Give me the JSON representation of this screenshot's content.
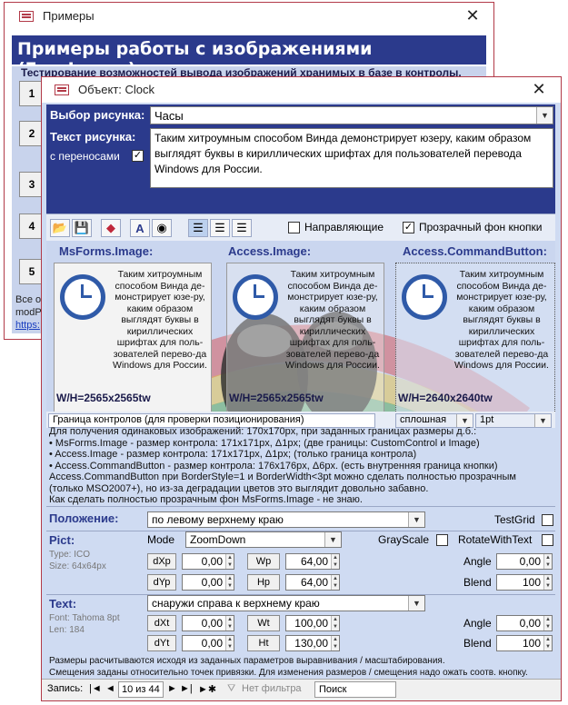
{
  "back_window": {
    "title": "Примеры",
    "close": "✕",
    "header": "Примеры работы с изображениями (FreeImage)",
    "subheader": "Тестирование возможностей вывода изображений хранимых в базе в контролы.",
    "buttons": [
      "1",
      "2",
      "3",
      "4",
      "5"
    ],
    "footer_line1": "Все ос",
    "footer_line2": "modPic",
    "footer_link": "https:"
  },
  "front_window": {
    "title": "Объект: Clock",
    "close": "✕",
    "select_label": "Выбор рисунка:",
    "select_value": "Часы",
    "text_label": "Текст рисунка:",
    "wrap_label": "с переносами",
    "wrap_checked": "✓",
    "text_value": "Таким хитроумным способом Винда демонстрирует юзеру, каким образом выглядят буквы в кириллических шрифтах для пользователей перевода Windows для России.",
    "toolbar": {
      "guides_label": "Направляющие",
      "transparent_label": "Прозрачный фон кнопки",
      "transparent_checked": "✓",
      "icons": [
        "open-icon",
        "save-icon",
        "eraser-icon",
        "font-icon",
        "color-icon",
        "align-left-icon",
        "align-center-icon",
        "align-right-icon"
      ]
    },
    "panes": [
      {
        "title": "MsForms.Image:",
        "text": "Таким хитроумным способом Винда де-монстрирует юзе-ру, каким образом выглядят буквы в кириллических шрифтах для поль-зователей перево-да Windows для России.",
        "wh": "W/H=2565x2565tw"
      },
      {
        "title": "Access.Image:",
        "text": "Таким хитроумным способом Винда де-монстрирует юзе-ру, каким образом выглядят буквы в кириллических шрифтах для поль-зователей перево-да Windows для России.",
        "wh": "W/H=2565x2565tw"
      },
      {
        "title": "Access.CommandButton:",
        "text": "Таким хитроумным способом Винда де-монстрирует юзе-ру, каким образом выглядят буквы в кириллических шрифтах для поль-зователей перево-да Windows для России.",
        "wh": "W/H=2640x2640tw"
      }
    ],
    "border_label": "Граница контролов (для проверки позиционирования)",
    "border_style": "сплошная",
    "border_width": "1pt",
    "info_lines": [
      "Для получения  одинаковых  изображений: 170x170px, при заданных границах размеры д.б.:",
      "• MsForms.Image           - размер контрола: 171x171px, Δ1px; (две границы: CustomControl и Image)",
      "• Access.Image              - размер контрола: 171x171px, Δ1px; (только граница контрола)",
      "• Access.CommandButton - размер контрола: 176x176px, Δ6px. (есть внутренняя граница кнопки)",
      "  Access.CommandButton при BorderStyle=1 и BorderWidth<3pt можно сделать полностью прозрачным",
      "  (только MSO2007+), но из-за деградации цветов это выглядит довольно забавно.",
      "  Как сделать полностью прозрачным фон MsForms.Image - не знаю."
    ],
    "position_label": "Положение:",
    "position_value": "по левому верхнему краю",
    "testgrid_label": "TestGrid",
    "pict": {
      "label": "Pict:",
      "type_note": "Type: ICO",
      "size_note": "Size: 64x64px",
      "mode_label": "Mode",
      "mode_value": "ZoomDown",
      "grayscale_label": "GrayScale",
      "rotate_label": "RotateWithText",
      "dxp_label": "dXp",
      "dxp_value": "0,00",
      "dyp_label": "dYp",
      "dyp_value": "0,00",
      "wp_label": "Wp",
      "wp_value": "64,00",
      "hp_label": "Hp",
      "hp_value": "64,00",
      "angle_label": "Angle",
      "angle_value": "0,00",
      "blend_label": "Blend",
      "blend_value": "100"
    },
    "text_sec": {
      "label": "Text:",
      "position_value": "снаружи справа к верхнему краю",
      "font_note": "Font: Tahoma 8pt",
      "len_note": "Len:  184",
      "dxt_label": "dXt",
      "dxt_value": "0,00",
      "dyt_label": "dYt",
      "dyt_value": "0,00",
      "wt_label": "Wt",
      "wt_value": "100,00",
      "ht_label": "Ht",
      "ht_value": "130,00",
      "angle_label": "Angle",
      "angle_value": "0,00",
      "blend_label": "Blend",
      "blend_value": "100"
    },
    "footnote1": "Размеры расчитываются исходя из заданных параметров выравнивания / масштабирования.",
    "footnote2": "Смещения заданы относительно точек привязки. Для изменения размеров / смещения надо ожать соотв. кнопку.",
    "nav": {
      "record_label": "Запись:",
      "first": "|◄",
      "prev": "◄",
      "position": "10 из 44",
      "next": "►",
      "last": "►|",
      "new": "►✱",
      "filter": "Нет фильтра",
      "search": "Поиск"
    }
  }
}
